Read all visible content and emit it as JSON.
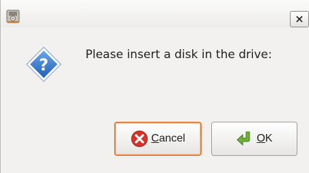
{
  "window": {
    "icon": "disk-drive-icon",
    "close_label": "×"
  },
  "dialog": {
    "icon": "question-icon",
    "message": "Please insert a disk in the drive:"
  },
  "buttons": {
    "cancel": {
      "mnemonic": "C",
      "rest": "ancel",
      "icon": "cancel-icon"
    },
    "ok": {
      "mnemonic": "O",
      "rest": "K",
      "icon": "ok-arrow-icon"
    }
  },
  "colors": {
    "focus_border": "#e5813a",
    "cancel_icon": "#d6342a",
    "ok_icon": "#6fb13a",
    "question_icon": "#2a6fc9"
  }
}
